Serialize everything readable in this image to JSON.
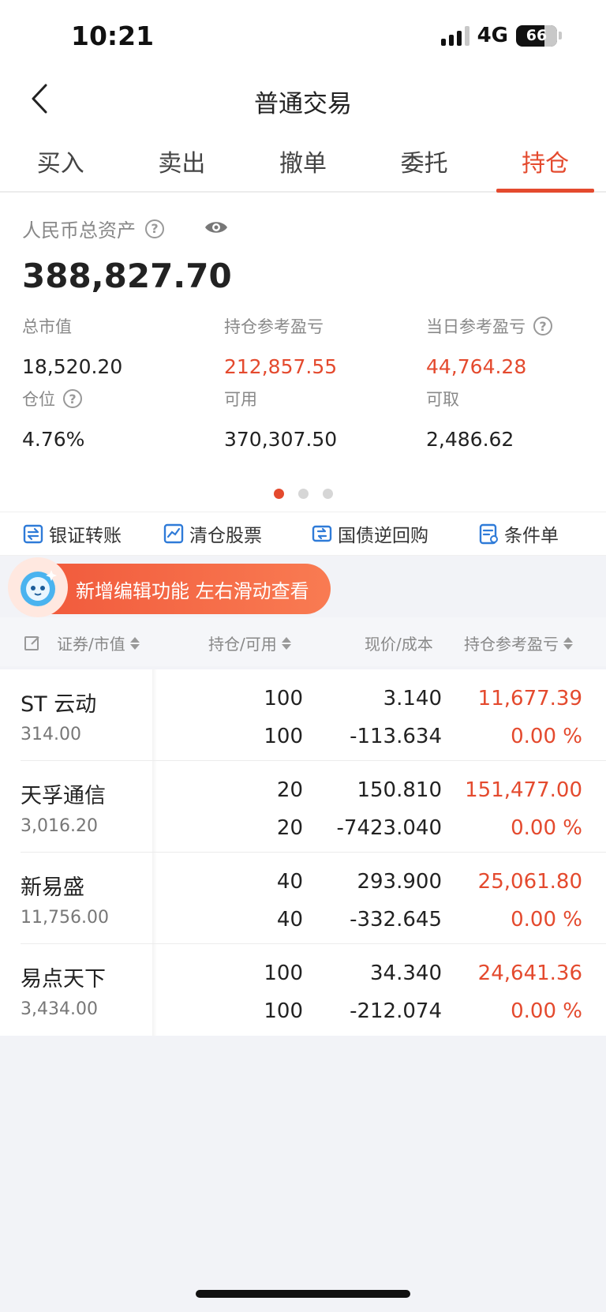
{
  "status": {
    "time": "10:21",
    "network": "4G",
    "battery": "66"
  },
  "nav": {
    "title": "普通交易"
  },
  "tabs": [
    {
      "label": "买入"
    },
    {
      "label": "卖出"
    },
    {
      "label": "撤单"
    },
    {
      "label": "委托"
    },
    {
      "label": "持仓",
      "active": true
    }
  ],
  "assets": {
    "total_label": "人民币总资产",
    "total_value": "388,827.70",
    "market_value_label": "总市值",
    "market_value": "18,520.20",
    "position_pl_label": "持仓参考盈亏",
    "position_pl": "212,857.55",
    "daily_pl_label": "当日参考盈亏",
    "daily_pl": "44,764.28",
    "position_ratio_label": "仓位",
    "position_ratio": "4.76%",
    "available_label": "可用",
    "available": "370,307.50",
    "withdrawable_label": "可取",
    "withdrawable": "2,486.62"
  },
  "quick_actions": [
    {
      "label": "银证转账",
      "icon": "transfer-icon"
    },
    {
      "label": "清仓股票",
      "icon": "chart-icon"
    },
    {
      "label": "国债逆回购",
      "icon": "bond-icon"
    },
    {
      "label": "条件单",
      "icon": "order-icon"
    }
  ],
  "banner": {
    "text": "新增编辑功能 左右滑动查看"
  },
  "table_header": {
    "col1": "证券/市值",
    "col2": "持仓/可用",
    "col3": "现价/成本",
    "col4": "持仓参考盈亏"
  },
  "holdings": [
    {
      "name": "ST 云动",
      "market_value": "314.00",
      "position": "100",
      "available": "100",
      "price": "3.140",
      "cost": "-113.634",
      "pl": "11,677.39",
      "pl_pct": "0.00 %"
    },
    {
      "name": "天孚通信",
      "market_value": "3,016.20",
      "position": "20",
      "available": "20",
      "price": "150.810",
      "cost": "-7423.040",
      "pl": "151,477.00",
      "pl_pct": "0.00 %"
    },
    {
      "name": "新易盛",
      "market_value": "11,756.00",
      "position": "40",
      "available": "40",
      "price": "293.900",
      "cost": "-332.645",
      "pl": "25,061.80",
      "pl_pct": "0.00 %"
    },
    {
      "name": "易点天下",
      "market_value": "3,434.00",
      "position": "100",
      "available": "100",
      "price": "34.340",
      "cost": "-212.074",
      "pl": "24,641.36",
      "pl_pct": "0.00 %"
    }
  ],
  "colors": {
    "accent": "#e44a2e",
    "background": "#f2f3f7"
  }
}
